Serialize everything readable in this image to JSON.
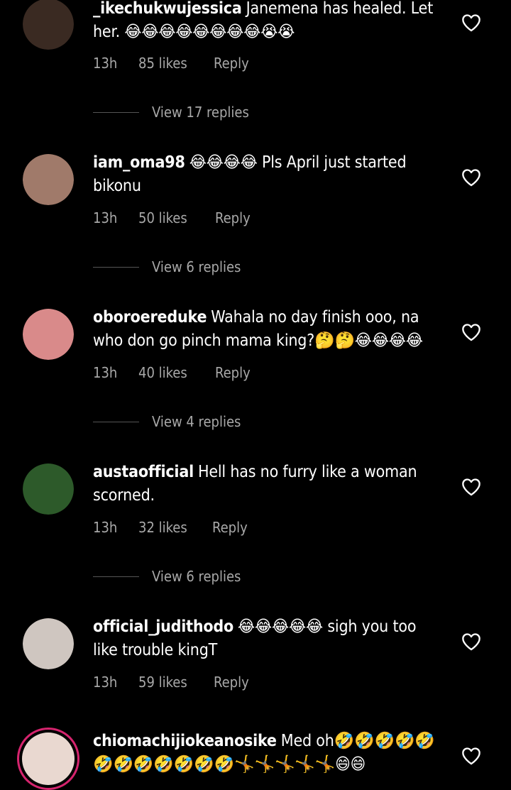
{
  "comments": [
    {
      "username": "_ikechukwujessica",
      "text": "Janemena has healed. Let her. 😂😂😂😂😂😂😂😂😭😭",
      "time": "13h",
      "likes": "85 likes",
      "reply": "Reply",
      "view_replies": "View 17 replies",
      "avatar_color": "#3a2a22"
    },
    {
      "username": "iam_oma98",
      "text": "😂😂😂😂 Pls April just started bikonu",
      "time": "13h",
      "likes": "50 likes",
      "reply": "Reply",
      "view_replies": "View 6 replies",
      "avatar_color": "#a07a6a"
    },
    {
      "username": "oboroereduke",
      "text": "Wahala no day finish ooo, na who don go pinch mama king?🤔🤔😂😂😂😂",
      "time": "13h",
      "likes": "40 likes",
      "reply": "Reply",
      "view_replies": "View 4 replies",
      "avatar_color": "#d98a8a"
    },
    {
      "username": "austaofficial",
      "text": "Hell has no furry like a woman scorned.",
      "time": "13h",
      "likes": "32 likes",
      "reply": "Reply",
      "view_replies": "View 6 replies",
      "avatar_color": "#2d5a2a"
    },
    {
      "username": "official_judithodo",
      "text": "😂😂😂😂😂 sigh you too like trouble kingT",
      "time": "13h",
      "likes": "59 likes",
      "reply": "Reply",
      "view_replies": "",
      "avatar_color": "#cfc6c0"
    },
    {
      "username": "chiomachijiokeanosike",
      "text": "Med oh🤣🤣🤣🤣🤣🤣🤣🤣🤣🤣🤣🤣🤸🤸🤸🤸🤸😄😄",
      "time": "",
      "likes": "",
      "reply": "",
      "view_replies": "",
      "avatar_color": "#e9d8d0"
    }
  ]
}
